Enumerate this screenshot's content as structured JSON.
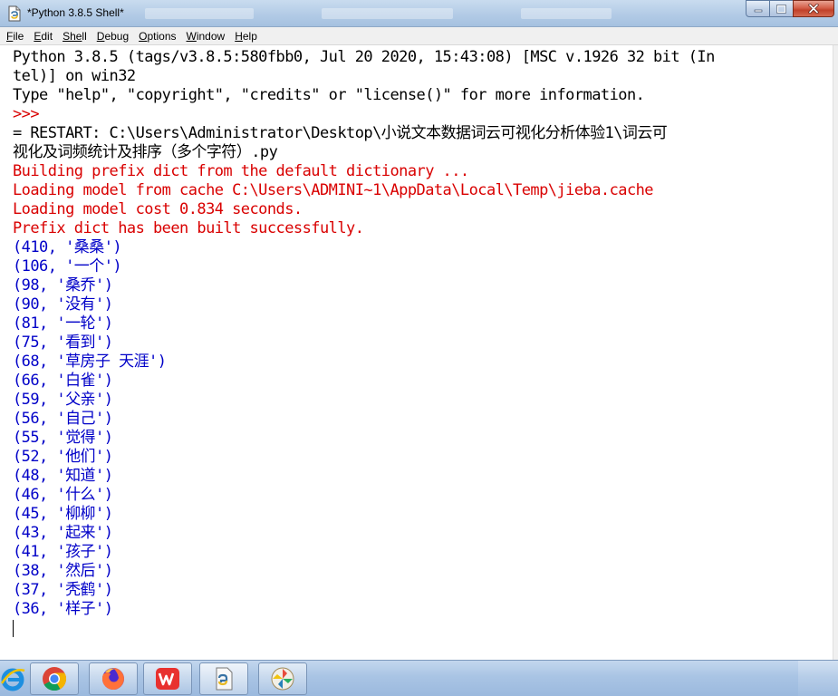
{
  "window": {
    "title": "*Python 3.8.5 Shell*"
  },
  "menu": {
    "items": [
      {
        "mnemonic": "F",
        "rest": "ile"
      },
      {
        "mnemonic": "E",
        "rest": "dit"
      },
      {
        "mnemonic": "She",
        "rest": "ll"
      },
      {
        "mnemonic": "D",
        "rest": "ebug"
      },
      {
        "mnemonic": "O",
        "rest": "ptions"
      },
      {
        "mnemonic": "W",
        "rest": "indow"
      },
      {
        "mnemonic": "H",
        "rest": "elp"
      }
    ]
  },
  "shell": {
    "colors": {
      "black": "#000000",
      "red": "#d90000",
      "blue": "#0000c8"
    },
    "lines": [
      {
        "text": "Python 3.8.5 (tags/v3.8.5:580fbb0, Jul 20 2020, 15:43:08) [MSC v.1926 32 bit (In",
        "color": "black"
      },
      {
        "text": "tel)] on win32",
        "color": "black"
      },
      {
        "text": "Type \"help\", \"copyright\", \"credits\" or \"license()\" for more information.",
        "color": "black"
      },
      {
        "text": ">>> ",
        "color": "red"
      },
      {
        "text": "= RESTART: C:\\Users\\Administrator\\Desktop\\小说文本数据词云可视化分析体验1\\词云可",
        "color": "black"
      },
      {
        "text": "视化及词频统计及排序（多个字符）.py",
        "color": "black"
      },
      {
        "text": "Building prefix dict from the default dictionary ...",
        "color": "red"
      },
      {
        "text": "Loading model from cache C:\\Users\\ADMINI~1\\AppData\\Local\\Temp\\jieba.cache",
        "color": "red"
      },
      {
        "text": "Loading model cost 0.834 seconds.",
        "color": "red"
      },
      {
        "text": "Prefix dict has been built successfully.",
        "color": "red"
      },
      {
        "text": "(410, '桑桑')",
        "color": "blue"
      },
      {
        "text": "(106, '一个')",
        "color": "blue"
      },
      {
        "text": "(98, '桑乔')",
        "color": "blue"
      },
      {
        "text": "(90, '没有')",
        "color": "blue"
      },
      {
        "text": "(81, '一轮')",
        "color": "blue"
      },
      {
        "text": "(75, '看到')",
        "color": "blue"
      },
      {
        "text": "(68, '草房子 天涯')",
        "color": "blue"
      },
      {
        "text": "(66, '白雀')",
        "color": "blue"
      },
      {
        "text": "(59, '父亲')",
        "color": "blue"
      },
      {
        "text": "(56, '自己')",
        "color": "blue"
      },
      {
        "text": "(55, '觉得')",
        "color": "blue"
      },
      {
        "text": "(52, '他们')",
        "color": "blue"
      },
      {
        "text": "(48, '知道')",
        "color": "blue"
      },
      {
        "text": "(46, '什么')",
        "color": "blue"
      },
      {
        "text": "(45, '柳柳')",
        "color": "blue"
      },
      {
        "text": "(43, '起来')",
        "color": "blue"
      },
      {
        "text": "(41, '孩子')",
        "color": "blue"
      },
      {
        "text": "(38, '然后')",
        "color": "blue"
      },
      {
        "text": "(37, '秃鹤')",
        "color": "blue"
      },
      {
        "text": "(36, '样子')",
        "color": "blue"
      }
    ]
  },
  "taskbar": {
    "buttons": [
      {
        "name": "internet-explorer-icon"
      },
      {
        "name": "chrome-icon"
      },
      {
        "name": "firefox-icon"
      },
      {
        "name": "wps-office-icon"
      },
      {
        "name": "python-idle-icon"
      },
      {
        "name": "pinwheel-app-icon"
      }
    ]
  }
}
